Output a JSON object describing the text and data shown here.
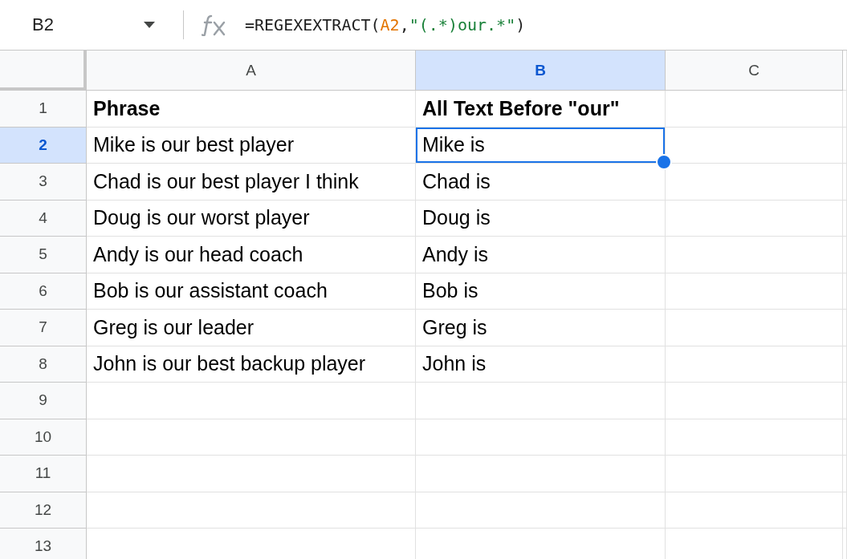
{
  "name_box": "B2",
  "formula": [
    {
      "kind": "plain",
      "text": "=REGEXEXTRACT("
    },
    {
      "kind": "ref",
      "text": "A2"
    },
    {
      "kind": "plain",
      "text": ","
    },
    {
      "kind": "string",
      "text": "\"(.*)our.*\""
    },
    {
      "kind": "plain",
      "text": ")"
    }
  ],
  "columns": [
    {
      "label": "A",
      "selected": false
    },
    {
      "label": "B",
      "selected": true
    },
    {
      "label": "C",
      "selected": false
    }
  ],
  "rows": [
    {
      "number": "1",
      "selected": false,
      "kind": "header",
      "cells": [
        {
          "text": "Phrase",
          "selected": false
        },
        {
          "text": "All Text Before \"our\"",
          "selected": false
        }
      ]
    },
    {
      "number": "2",
      "selected": true,
      "kind": "data",
      "cells": [
        {
          "text": "Mike is our best player",
          "selected": false
        },
        {
          "text": "Mike is",
          "selected": true
        }
      ]
    },
    {
      "number": "3",
      "selected": false,
      "kind": "data",
      "cells": [
        {
          "text": "Chad is our best player I think",
          "selected": false
        },
        {
          "text": "Chad is",
          "selected": false
        }
      ]
    },
    {
      "number": "4",
      "selected": false,
      "kind": "data",
      "cells": [
        {
          "text": "Doug is our worst player",
          "selected": false
        },
        {
          "text": "Doug is",
          "selected": false
        }
      ]
    },
    {
      "number": "5",
      "selected": false,
      "kind": "data",
      "cells": [
        {
          "text": "Andy is our head coach",
          "selected": false
        },
        {
          "text": "Andy is",
          "selected": false
        }
      ]
    },
    {
      "number": "6",
      "selected": false,
      "kind": "data",
      "cells": [
        {
          "text": "Bob is our assistant coach",
          "selected": false
        },
        {
          "text": "Bob is",
          "selected": false
        }
      ]
    },
    {
      "number": "7",
      "selected": false,
      "kind": "data",
      "cells": [
        {
          "text": "Greg is our leader",
          "selected": false
        },
        {
          "text": "Greg is",
          "selected": false
        }
      ]
    },
    {
      "number": "8",
      "selected": false,
      "kind": "data",
      "cells": [
        {
          "text": "John is our best backup player",
          "selected": false
        },
        {
          "text": "John is",
          "selected": false
        }
      ]
    },
    {
      "number": "9",
      "selected": false
    },
    {
      "number": "10",
      "selected": false
    },
    {
      "number": "11",
      "selected": false
    },
    {
      "number": "12",
      "selected": false
    },
    {
      "number": "13",
      "selected": false
    }
  ]
}
